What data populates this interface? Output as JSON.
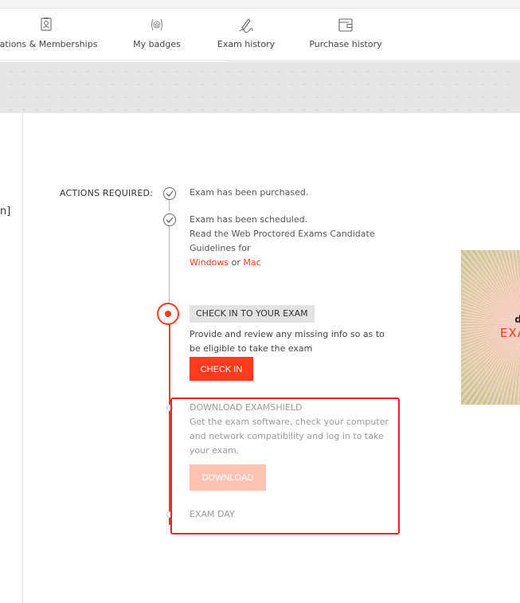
{
  "tabs": [
    {
      "label": "cations & Memberships",
      "icon": "badge-card-icon"
    },
    {
      "label": "My badges",
      "icon": "star-badge-icon"
    },
    {
      "label": "Exam history",
      "icon": "signature-icon"
    },
    {
      "label": "Purchase history",
      "icon": "wallet-icon"
    }
  ],
  "left_fragment": "n]",
  "actions": {
    "label": "ACTIONS REQUIRED:",
    "step1": {
      "text": "Exam has been purchased."
    },
    "step2": {
      "line1": "Exam has been scheduled.",
      "line2": "Read the Web Proctored Exams Candidate",
      "line3": "Guidelines for",
      "link_windows": "Windows",
      "or_text": "or",
      "link_mac": "Mac"
    },
    "step3": {
      "heading": "CHECK IN TO YOUR EXAM",
      "line1": "Provide and review any missing info so as to",
      "line2": "be eligible to take the exam",
      "button": "CHECK IN"
    },
    "step4": {
      "heading": "DOWNLOAD EXAMSHIELD",
      "line1": "Get the exam software, check your computer",
      "line2": "and network compatibility and log in to take",
      "line3": "your exam.",
      "button": "DOWNLOAD"
    },
    "step5": {
      "heading": "EXAM DAY"
    }
  },
  "promo": {
    "line1": "d",
    "line2": "EXA"
  },
  "colors": {
    "accent": "#ff3b1f",
    "accent_disabled": "#ffc2b3",
    "highlight_box": "#e8232b"
  }
}
